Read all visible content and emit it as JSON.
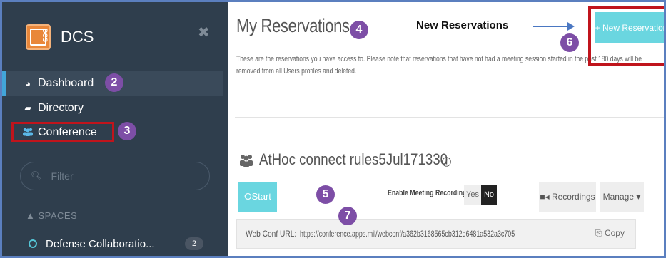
{
  "sidebar": {
    "logo_text": "DCS",
    "app_name": "DCS",
    "nav": [
      {
        "label": "Dashboard",
        "icon": "dashboard-icon"
      },
      {
        "label": "Directory",
        "icon": "book-icon"
      },
      {
        "label": "Conference",
        "icon": "users-icon"
      }
    ],
    "filter_placeholder": "Filter",
    "spaces_heading": "SPACES",
    "spaces": [
      {
        "label": "Defense Collaboratio...",
        "count": "2"
      }
    ]
  },
  "main": {
    "title": "My Reservations",
    "description": "These are the reservations you have access to. Please note that reservations that have not had a meeting session started in the past 180 days will be removed from all Users profiles and deleted.",
    "new_reservation_button": "+ New Reservation",
    "conference": {
      "title": "AtHoc connect rules5Jul171330",
      "start_button": "Start",
      "recording_label": "Enable Meeting Recording:",
      "yes": "Yes",
      "no": "No",
      "recordings_button": "Recordings",
      "manage_button": "Manage",
      "url_label": "Web Conf URL:",
      "url_value": "https://conference.apps.mil/webconf/a362b3168565cb312d6481a532a3c705",
      "copy_button": "Copy"
    }
  },
  "annotations": {
    "callout_text": "New Reservations",
    "badges": [
      "2",
      "3",
      "4",
      "5",
      "6",
      "7"
    ]
  },
  "colors": {
    "sidebar_bg": "#2f3e4d",
    "accent_cyan": "#6ad6e0",
    "badge_purple": "#7d4ea6",
    "highlight_red": "#c0141c",
    "arrow_blue": "#4a77c2"
  }
}
